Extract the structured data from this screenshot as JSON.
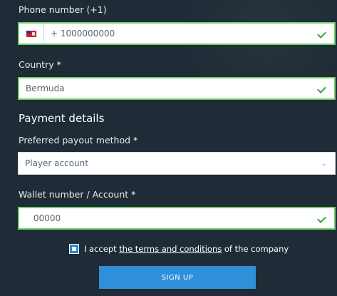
{
  "phone": {
    "label": "Phone number (+1)",
    "value": "+ 1000000000",
    "flag": "bermuda-flag-icon"
  },
  "country": {
    "label": "Country",
    "required_mark": "*",
    "value": "Bermuda"
  },
  "payment": {
    "section_title": "Payment details",
    "method_label": "Preferred payout method",
    "method_required_mark": "*",
    "method_value": "Player account",
    "wallet_label": "Wallet number / Account",
    "wallet_required_mark": "*",
    "wallet_value": "00000"
  },
  "terms": {
    "prefix": "I accept ",
    "link_text": "the terms and conditions",
    "suffix": " of the company",
    "checked": true
  },
  "signup": {
    "label": "SIGN UP"
  },
  "colors": {
    "background": "#1f2b36",
    "valid_border": "#6fd06a",
    "check": "#3aa53a",
    "button": "#2f8fd8"
  }
}
